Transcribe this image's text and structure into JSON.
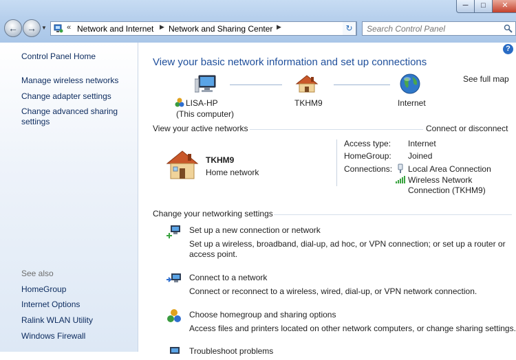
{
  "window": {
    "minimize_glyph": "─",
    "maximize_glyph": "□",
    "close_glyph": "✕"
  },
  "nav": {
    "back_glyph": "←",
    "forward_glyph": "→",
    "history_dropdown_glyph": "▼"
  },
  "address_bar": {
    "chevron": "«",
    "crumbs": [
      "Network and Internet",
      "Network and Sharing Center"
    ],
    "separator": "▶",
    "dropdown_glyph": "▼",
    "refresh_glyph": "↻"
  },
  "search": {
    "placeholder": "Search Control Panel"
  },
  "sidebar": {
    "home": "Control Panel Home",
    "tasks": [
      "Manage wireless networks",
      "Change adapter settings",
      "Change advanced sharing settings"
    ],
    "see_also_heading": "See also",
    "see_also": [
      "HomeGroup",
      "Internet Options",
      "Ralink WLAN Utility",
      "Windows Firewall"
    ]
  },
  "main": {
    "help_glyph": "?",
    "heading": "View your basic network information and set up connections",
    "see_full_map": "See full map",
    "map": {
      "computer": "LISA-HP",
      "computer_sub": "(This computer)",
      "network": "TKHM9",
      "internet": "Internet"
    },
    "active_networks_label": "View your active networks",
    "connect_disconnect": "Connect or disconnect",
    "active": {
      "name": "TKHM9",
      "type": "Home network",
      "access_type_label": "Access type:",
      "access_type_value": "Internet",
      "homegroup_label": "HomeGroup:",
      "homegroup_value": "Joined",
      "connections_label": "Connections:",
      "connection_1": "Local Area Connection",
      "connection_2_line1": "Wireless Network",
      "connection_2_line2": "Connection (TKHM9)"
    },
    "change_settings_label": "Change your networking settings",
    "tasks": [
      {
        "title": "Set up a new connection or network",
        "desc1": "Set up a wireless, broadband, dial-up, ad hoc, or VPN connection; or set up a router or",
        "desc2": "access point."
      },
      {
        "title": "Connect to a network",
        "desc1": "Connect or reconnect to a wireless, wired, dial-up, or VPN network connection."
      },
      {
        "title": "Choose homegroup and sharing options",
        "desc1": "Access files and printers located on other network computers, or change sharing settings."
      },
      {
        "title": "Troubleshoot problems"
      }
    ]
  }
}
